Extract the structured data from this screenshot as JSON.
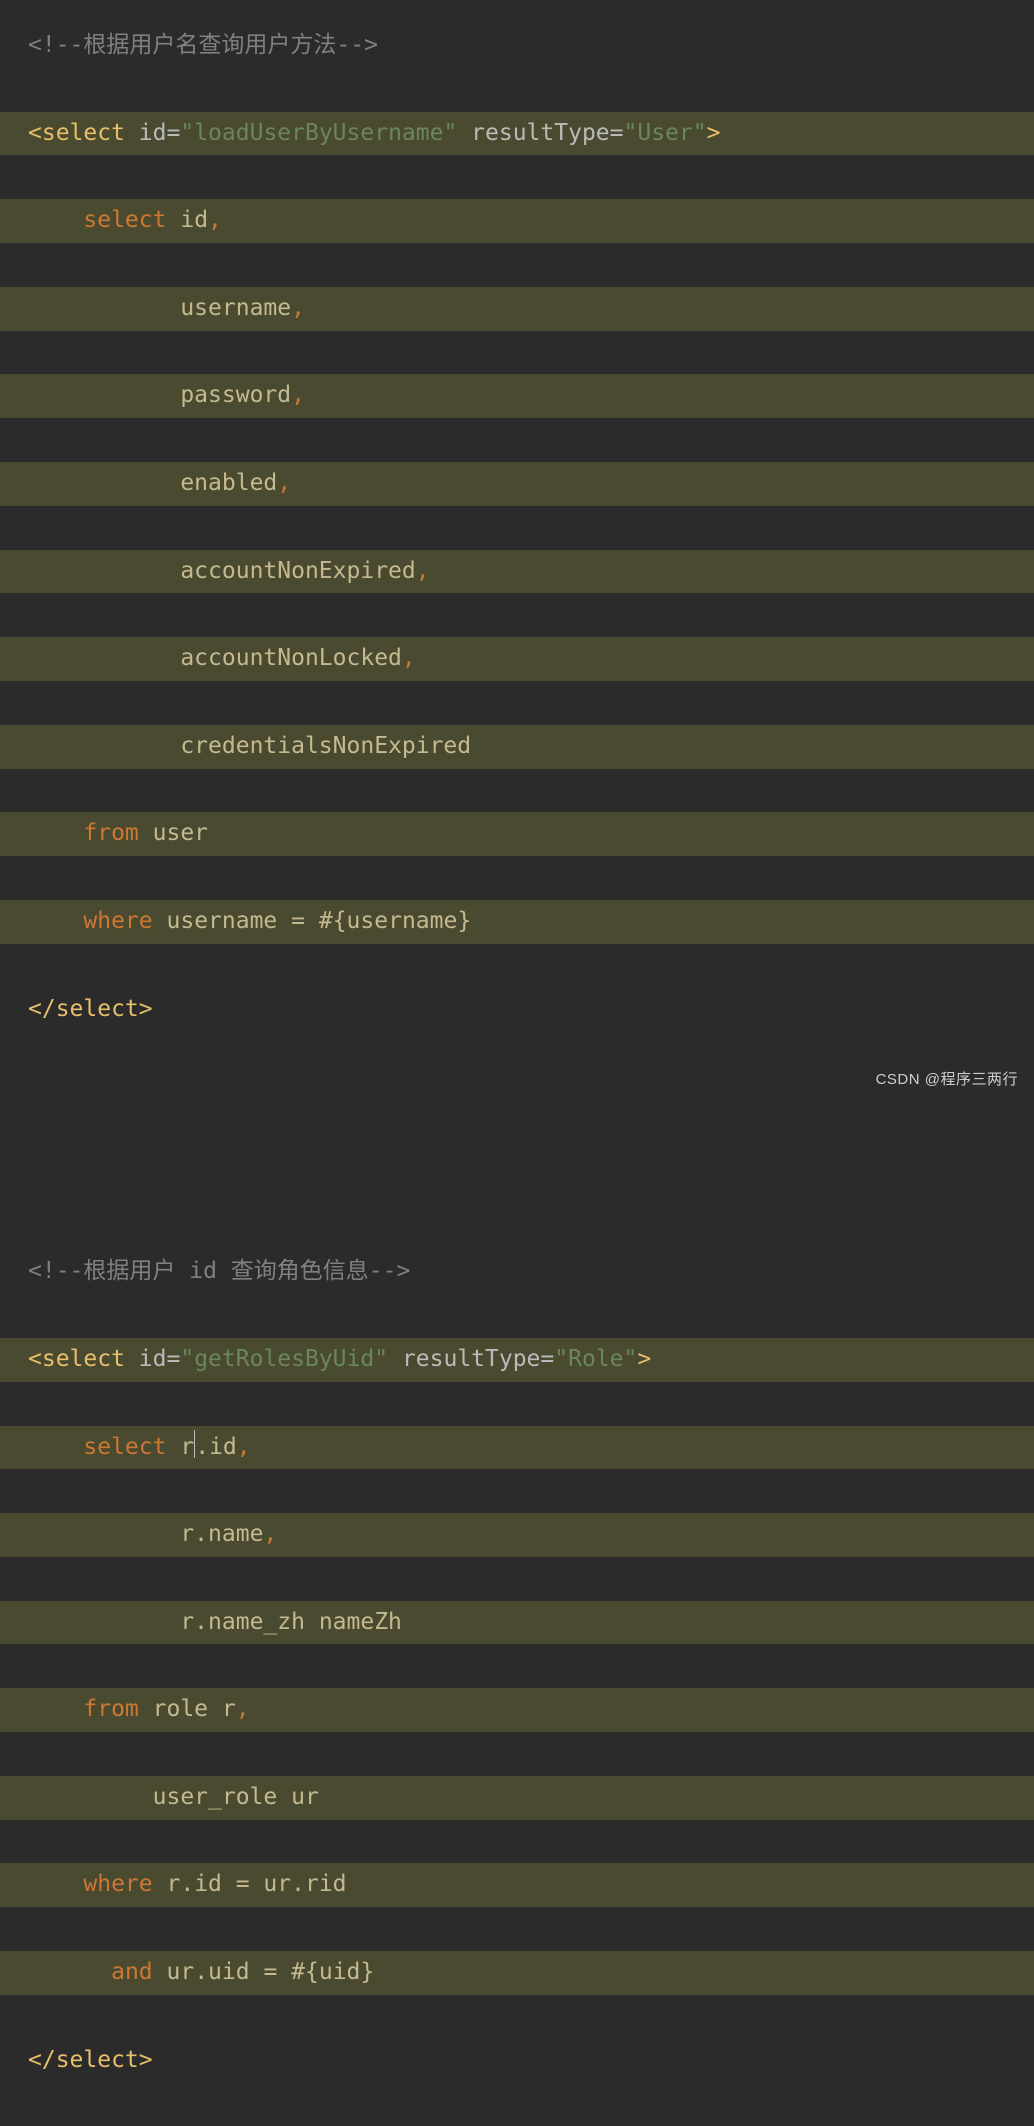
{
  "block1": {
    "comment": "<!--根据用户名查询用户方法-->",
    "tag_open": "<select",
    "attr_id_name": "id",
    "attr_id_val": "\"loadUserByUsername\"",
    "attr_rt_name": "resultType",
    "attr_rt_val": "\"User\"",
    "tag_open_end": ">",
    "kw_select": "select",
    "col_id": "id",
    "col_username": "username",
    "col_password": "password",
    "col_enabled": "enabled",
    "col_acc_nonexp": "accountNonExpired",
    "col_acc_nonlock": "accountNonLocked",
    "col_cred_nonexp": "credentialsNonExpired",
    "kw_from": "from",
    "tbl_user": "user",
    "kw_where": "where",
    "where_col": "username",
    "where_eq": "=",
    "where_param": "#{username}",
    "tag_close": "</select>"
  },
  "block2": {
    "comment": "<!--根据用户 id 查询角色信息-->",
    "tag_open": "<select",
    "attr_id_name": "id",
    "attr_id_val": "\"getRolesByUid\"",
    "attr_rt_name": "resultType",
    "attr_rt_val": "\"Role\"",
    "tag_open_end": ">",
    "kw_select": "select",
    "col1_pre": "r",
    "col1_dot": ".",
    "col1_name": "id",
    "col2": "r.name",
    "col3": "r.name_zh",
    "col3_alias": "nameZh",
    "kw_from": "from",
    "tbl_role": "role",
    "alias_r": "r",
    "tbl_userrole": "user_role",
    "alias_ur": "ur",
    "kw_where": "where",
    "where1": "r.id = ur.rid",
    "kw_and": "and",
    "where2_lhs": "ur.uid",
    "where2_eq": "=",
    "where2_param": "#{uid}",
    "tag_close": "</select>"
  },
  "watermark": "CSDN @程序三两行"
}
